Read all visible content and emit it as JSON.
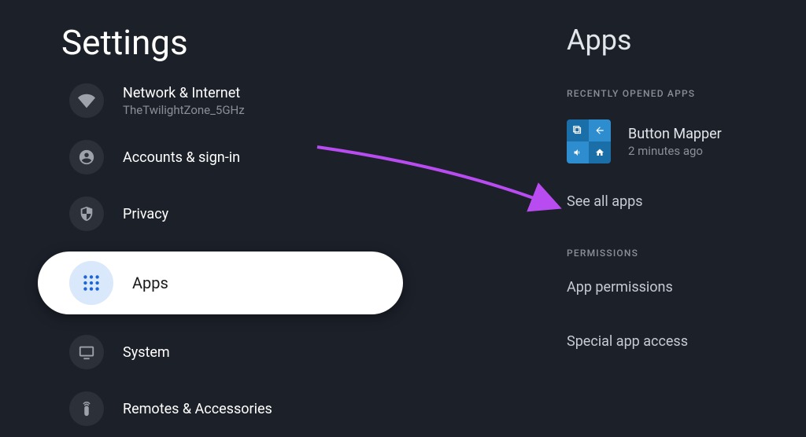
{
  "settings": {
    "title": "Settings",
    "items": [
      {
        "id": "network",
        "title": "Network & Internet",
        "subtitle": "TheTwilightZone_5GHz"
      },
      {
        "id": "accounts",
        "title": "Accounts & sign-in",
        "subtitle": ""
      },
      {
        "id": "privacy",
        "title": "Privacy",
        "subtitle": ""
      },
      {
        "id": "apps",
        "title": "Apps",
        "subtitle": ""
      },
      {
        "id": "system",
        "title": "System",
        "subtitle": ""
      },
      {
        "id": "remotes",
        "title": "Remotes & Accessories",
        "subtitle": ""
      }
    ]
  },
  "right": {
    "title": "Apps",
    "section_recent": "RECENTLY OPENED APPS",
    "recent_app": {
      "name": "Button Mapper",
      "time": "2 minutes ago"
    },
    "see_all": "See all apps",
    "section_permissions": "PERMISSIONS",
    "app_permissions": "App permissions",
    "special_access": "Special app access"
  }
}
